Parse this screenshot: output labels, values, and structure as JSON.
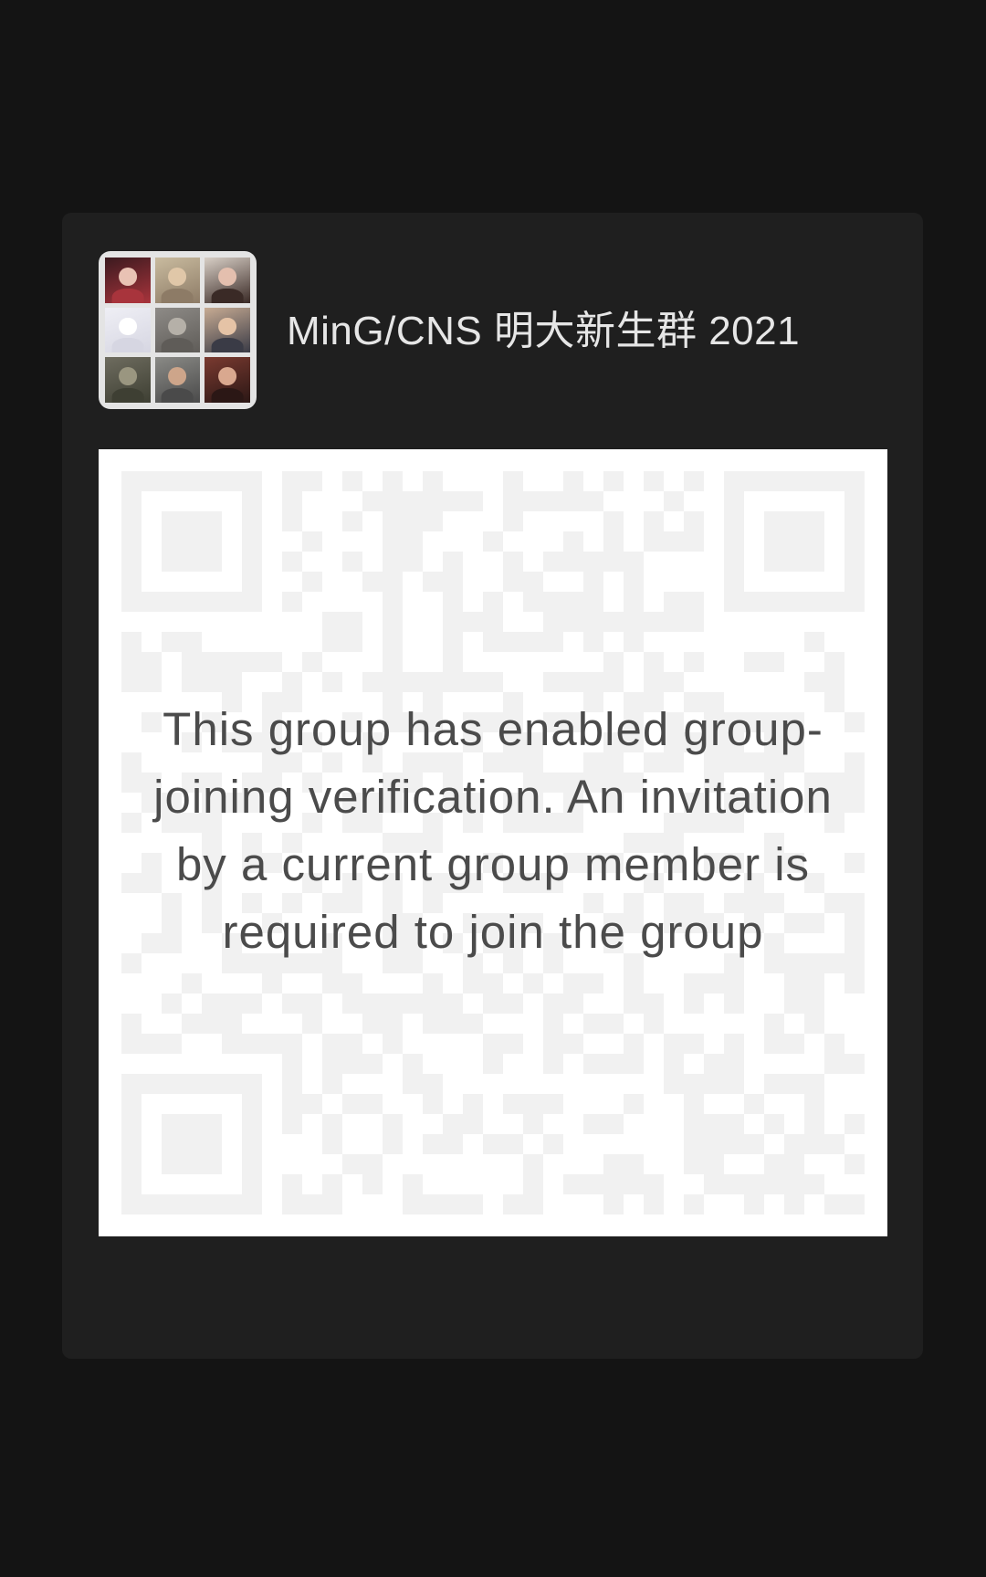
{
  "group": {
    "name": "MinG/CNS 明大新生群 2021",
    "avatar_tiles": [
      {
        "icon": "red-haired-girl-avatar",
        "bg": "#3b1a1f",
        "accent": "#a8343c",
        "skin": "#e9c2b4"
      },
      {
        "icon": "figure-on-beige-avatar",
        "bg": "#c9bb9f",
        "accent": "#8d7b66",
        "skin": "#e0c7a8"
      },
      {
        "icon": "woman-dark-hair-avatar",
        "bg": "#d8cfc6",
        "accent": "#3a2a26",
        "skin": "#e4bfae"
      },
      {
        "icon": "white-rabbit-avatar",
        "bg": "#efeff5",
        "accent": "#d6d6e2",
        "skin": "#ffffff"
      },
      {
        "icon": "tabby-cat-avatar",
        "bg": "#8e8b87",
        "accent": "#5f5c58",
        "skin": "#b5b0a8"
      },
      {
        "icon": "couple-avatar",
        "bg": "#c7ab93",
        "accent": "#3a3b46",
        "skin": "#e5c3a6"
      },
      {
        "icon": "landscape-avatar",
        "bg": "#6e6c5f",
        "accent": "#3e3f33",
        "skin": "#9a9680"
      },
      {
        "icon": "man-sunglasses-avatar",
        "bg": "#8a8a86",
        "accent": "#4a4a4a",
        "skin": "#cda58a"
      },
      {
        "icon": "dark-haired-person-avatar",
        "bg": "#7a3a30",
        "accent": "#2b1715",
        "skin": "#d9a88f"
      }
    ]
  },
  "qr": {
    "message": "This group has enabled group-joining verification. An invitation by a current group member is required to join the group"
  },
  "colors": {
    "page_background": "#141414",
    "card_background": "#1f1f1f",
    "group_name_text": "#e6e6e6",
    "qr_background": "#ffffff",
    "qr_pattern": "#f1f1f1",
    "message_text": "#4b4b4b"
  }
}
